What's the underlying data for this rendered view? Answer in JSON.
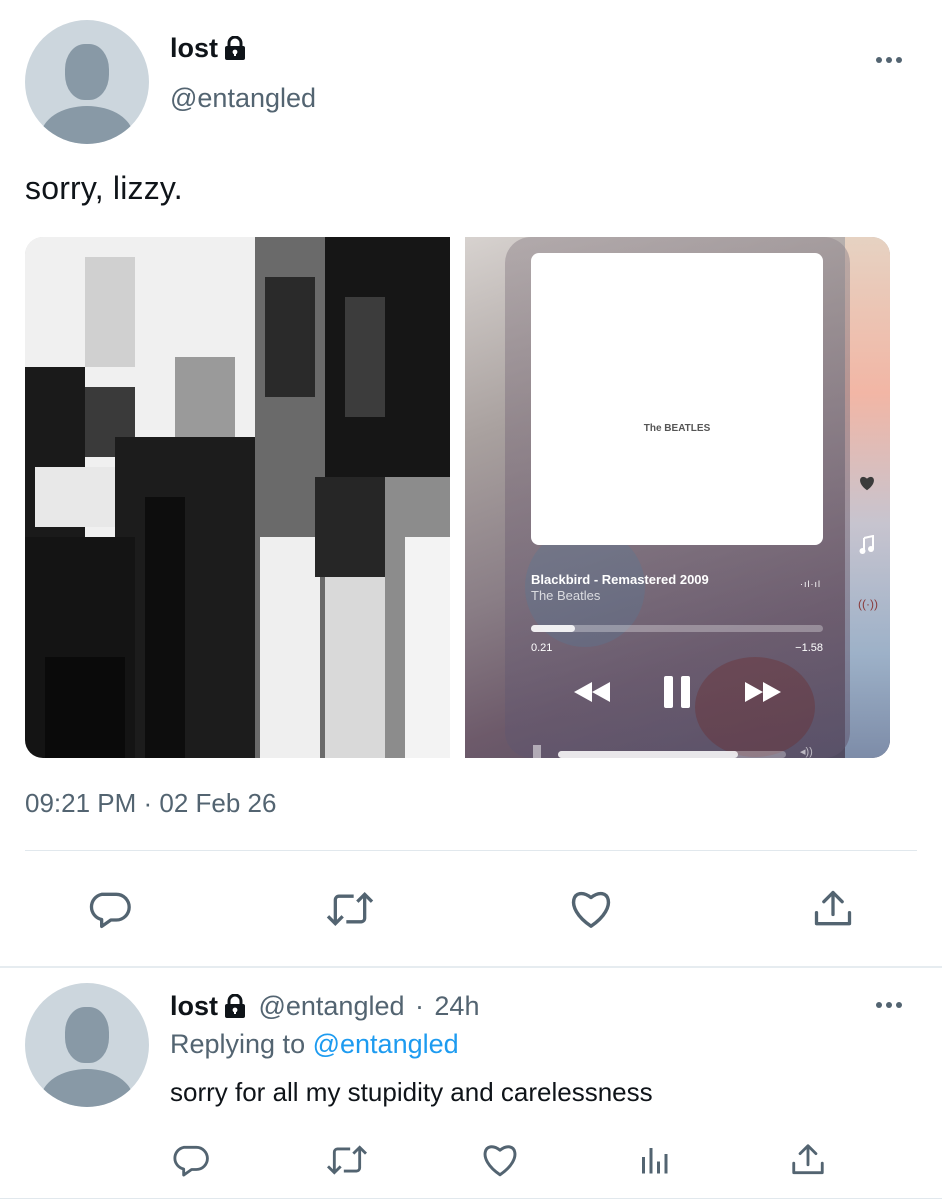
{
  "tweet": {
    "display_name": "lost",
    "handle": "@entangled",
    "text": "sorry, lizzy.",
    "timestamp": "09:21 PM · 02 Feb 26",
    "media": {
      "painting_alt": "abstract black and white painting",
      "player": {
        "album_label": "The BEATLES",
        "song_title": "Blackbird - Remastered 2009",
        "artist": "The Beatles",
        "elapsed": "0.21",
        "remaining": "−1.58",
        "progress": 0.15,
        "volume": 0.79
      }
    },
    "actions": [
      "reply-icon",
      "retweet-icon",
      "like-icon",
      "share-icon"
    ]
  },
  "reply": {
    "display_name": "lost",
    "handle": "@entangled",
    "separator": "·",
    "age": "24h",
    "replying_prefix": "Replying to",
    "replying_handle": "@entangled",
    "text": "sorry for all my stupidity and carelessness",
    "actions": [
      "reply-icon",
      "retweet-icon",
      "like-icon",
      "analytics-icon",
      "share-icon"
    ]
  },
  "colors": {
    "text": "#0f1419",
    "secondary": "#536471",
    "link": "#1d9bf0",
    "avatar_bg": "#ccd6dd",
    "avatar_fg": "#8899a6",
    "divider": "#e1e8ed"
  }
}
